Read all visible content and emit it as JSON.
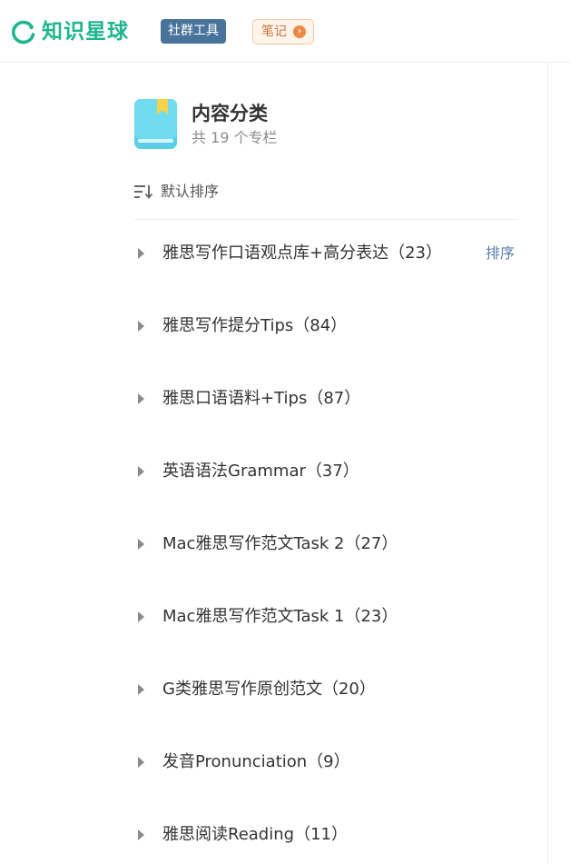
{
  "header": {
    "brand": "知识星球",
    "community_tools": "社群工具",
    "notes": "笔记",
    "notes_badge": "›"
  },
  "category": {
    "title": "内容分类",
    "count_text": "共 19 个专栏",
    "sort_label": "默认排序",
    "items": [
      {
        "label": "雅思写作口语观点库+高分表达（23）",
        "action": "排序"
      },
      {
        "label": "雅思写作提分Tips（84）"
      },
      {
        "label": "雅思口语语料+Tips（87）"
      },
      {
        "label": "英语语法Grammar（37）"
      },
      {
        "label": "Mac雅思写作范文Task 2（27）"
      },
      {
        "label": "Mac雅思写作范文Task 1（23）"
      },
      {
        "label": "G类雅思写作原创范文（20）"
      },
      {
        "label": "发音Pronunciation（9）"
      },
      {
        "label": "雅思阅读Reading（11）"
      }
    ]
  },
  "colors": {
    "brand_green": "#1fb58f",
    "tools_pill": "#49739b",
    "notes_accent": "#ea8a46",
    "book_icon": "#5ad0e8",
    "bookmark": "#f6d24a",
    "link_blue": "#5a7ea8"
  },
  "icons": {
    "logo": "planet-ring-icon",
    "notes": "chevron-right-circle-icon",
    "category": "book-icon",
    "sort": "sort-lines-icon",
    "item": "caret-right-icon"
  }
}
